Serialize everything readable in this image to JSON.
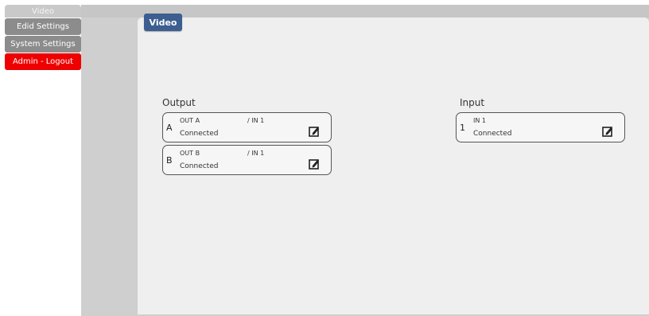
{
  "sidebar": {
    "items": [
      {
        "label": "Video",
        "active": true
      },
      {
        "label": "Edid Settings"
      },
      {
        "label": "System Settings"
      },
      {
        "label": "Admin - Logout"
      }
    ]
  },
  "panel": {
    "tab_label": "Video",
    "output_label": "Output",
    "input_label": "Input"
  },
  "outputs": [
    {
      "letter": "A",
      "name": "OUT A",
      "route": "/  IN 1",
      "status": "Connected"
    },
    {
      "letter": "B",
      "name": "OUT B",
      "route": "/  IN 1",
      "status": "Connected"
    }
  ],
  "inputs": [
    {
      "number": "1",
      "name": "IN 1",
      "status": "Connected"
    }
  ],
  "icons": {
    "edit": "edit-icon"
  },
  "colors": {
    "tab": "#3c5e91",
    "logout": "#ee0000",
    "nav": "#8c8c8c"
  }
}
